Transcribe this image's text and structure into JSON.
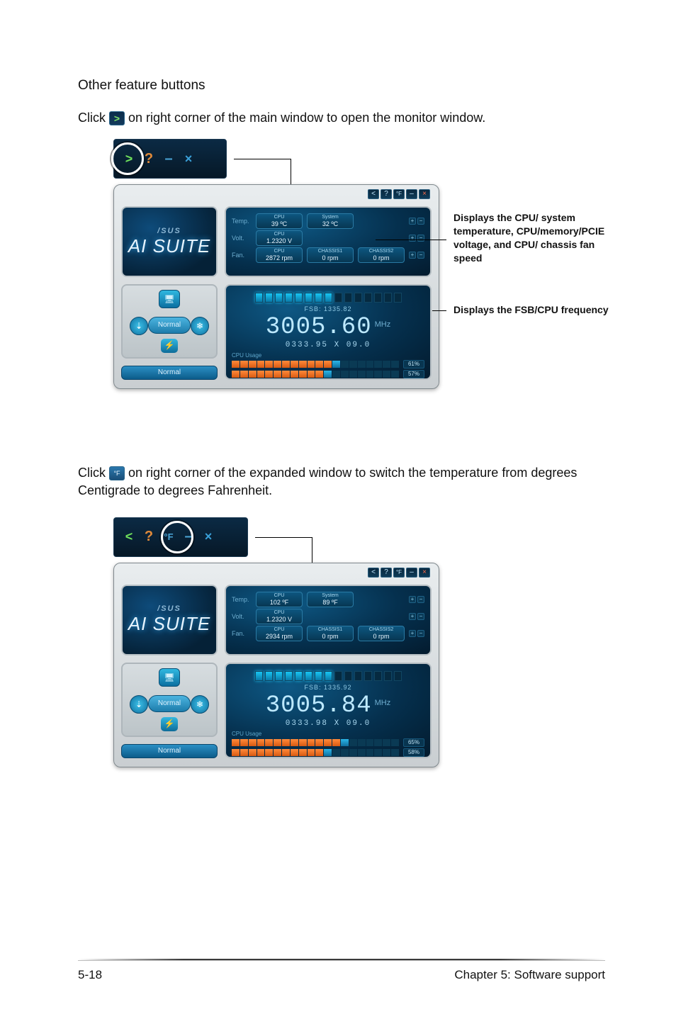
{
  "page": {
    "heading": "Other feature buttons",
    "line1a": "Click ",
    "line1b": " on right corner of the main window to open the monitor window.",
    "line2a": "Click ",
    "line2b": " on right corner of the expanded window to switch the temperature from degrees Centigrade to degrees Fahrenheit.",
    "footer_left": "5-18",
    "footer_right": "Chapter 5: Software support"
  },
  "callout": {
    "monitor": "Displays the CPU/ system temperature, CPU/memory/PCIE voltage, and CPU/ chassis fan speed",
    "freq": "Displays the FSB/CPU frequency"
  },
  "titlebar": {
    "collapse": "<",
    "help": "?",
    "unit": "°F",
    "min": "–",
    "close": "×"
  },
  "brand": {
    "logo": "/SUS",
    "name": "AI SUITE"
  },
  "mode": {
    "label": "Normal",
    "status": "Normal"
  },
  "app1": {
    "temp": {
      "label": "Temp.",
      "cpu_t": "CPU",
      "cpu_v": "39 ºC",
      "sys_t": "System",
      "sys_v": "32 ºC"
    },
    "volt": {
      "label": "Volt.",
      "cpu_t": "CPU",
      "cpu_v": "1.2320 V"
    },
    "fan": {
      "label": "Fan.",
      "cpu_t": "CPU",
      "cpu_v": "2872 rpm",
      "c1_t": "CHASSIS1",
      "c1_v": "0 rpm",
      "c2_t": "CHASSIS2",
      "c2_v": "0 rpm"
    },
    "freq": {
      "fsb_label": "FSB:",
      "fsb": "1335.82",
      "cpu": "3005.60",
      "unit": "MHz",
      "mult": "0333.95 X 09.0",
      "usage_label": "CPU Usage",
      "u1": "61%",
      "u2": "57%"
    }
  },
  "app2": {
    "temp": {
      "label": "Temp.",
      "cpu_t": "CPU",
      "cpu_v": "102 ºF",
      "sys_t": "System",
      "sys_v": "89 ºF"
    },
    "volt": {
      "label": "Volt.",
      "cpu_t": "CPU",
      "cpu_v": "1.2320 V"
    },
    "fan": {
      "label": "Fan.",
      "cpu_t": "CPU",
      "cpu_v": "2934 rpm",
      "c1_t": "CHASSIS1",
      "c1_v": "0 rpm",
      "c2_t": "CHASSIS2",
      "c2_v": "0 rpm"
    },
    "freq": {
      "fsb_label": "FSB:",
      "fsb": "1335.92",
      "cpu": "3005.84",
      "unit": "MHz",
      "mult": "0333.98 X 09.0",
      "usage_label": "CPU Usage",
      "u1": "65%",
      "u2": "58%"
    }
  }
}
